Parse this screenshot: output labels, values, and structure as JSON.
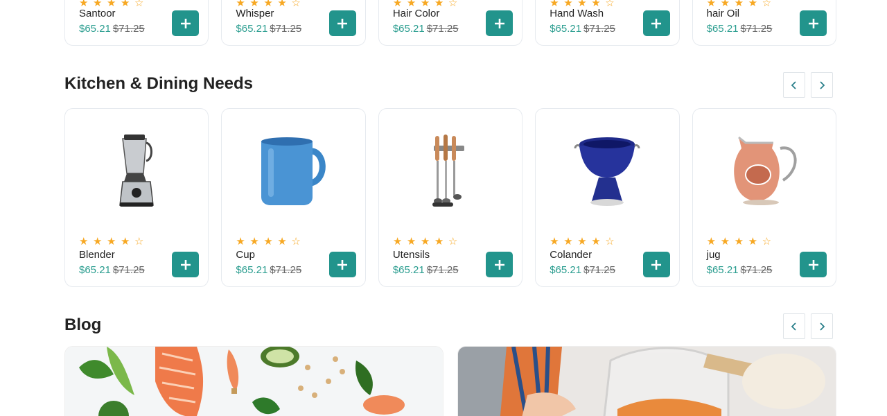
{
  "top_row": {
    "products": [
      {
        "name": "Santoor",
        "price": "$65.21",
        "old_price": "$71.25",
        "rating": 4
      },
      {
        "name": "Whisper",
        "price": "$65.21",
        "old_price": "$71.25",
        "rating": 4
      },
      {
        "name": "Hair Color",
        "price": "$65.21",
        "old_price": "$71.25",
        "rating": 4
      },
      {
        "name": "Hand Wash",
        "price": "$65.21",
        "old_price": "$71.25",
        "rating": 4
      },
      {
        "name": "hair Oil",
        "price": "$65.21",
        "old_price": "$71.25",
        "rating": 4
      }
    ]
  },
  "kitchen": {
    "title": "Kitchen & Dining Needs",
    "products": [
      {
        "name": "Blender",
        "price": "$65.21",
        "old_price": "$71.25",
        "rating": 4,
        "icon": "blender-image"
      },
      {
        "name": "Cup",
        "price": "$65.21",
        "old_price": "$71.25",
        "rating": 4,
        "icon": "cup-image"
      },
      {
        "name": "Utensils",
        "price": "$65.21",
        "old_price": "$71.25",
        "rating": 4,
        "icon": "utensils-image"
      },
      {
        "name": "Colander",
        "price": "$65.21",
        "old_price": "$71.25",
        "rating": 4,
        "icon": "colander-image"
      },
      {
        "name": "jug",
        "price": "$65.21",
        "old_price": "$71.25",
        "rating": 4,
        "icon": "jug-image"
      }
    ]
  },
  "blog": {
    "title": "Blog"
  },
  "colors": {
    "accent": "#22948c",
    "price": "#2a9d8f",
    "star": "#f7a823"
  }
}
